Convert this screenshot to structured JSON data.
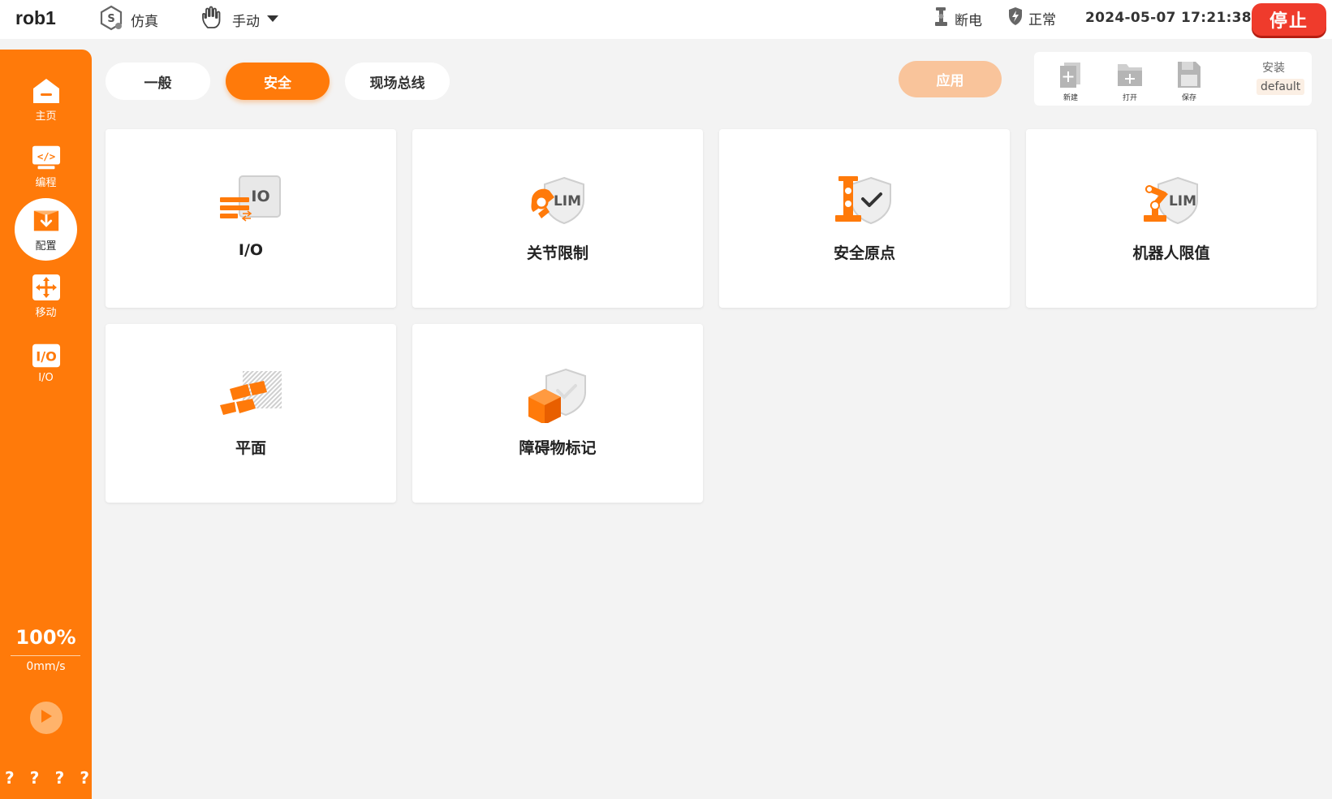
{
  "topbar": {
    "robot_name": "rob1",
    "sim_mode": "仿真",
    "manual_mode": "手动",
    "power_status": "断电",
    "safety_status": "正常",
    "datetime": "2024-05-07 17:21:38",
    "stop_label": "停止"
  },
  "sidebar": {
    "items": [
      {
        "label": "主页",
        "icon": "home-icon"
      },
      {
        "label": "编程",
        "icon": "code-icon"
      },
      {
        "label": "配置",
        "icon": "config-icon"
      },
      {
        "label": "移动",
        "icon": "move-icon"
      },
      {
        "label": "I/O",
        "icon": "io-icon"
      }
    ],
    "active_index": 2,
    "speed_percent": "100%",
    "speed_value": "0mm/s",
    "help": [
      "?",
      "?",
      "?",
      "?"
    ]
  },
  "tabs": [
    {
      "label": "一般",
      "active": false
    },
    {
      "label": "安全",
      "active": true
    },
    {
      "label": "现场总线",
      "active": false
    }
  ],
  "apply_label": "应用",
  "file_panel": {
    "new_label": "新建",
    "open_label": "打开",
    "save_label": "保存",
    "install_label": "安装",
    "install_value": "default"
  },
  "cards": [
    {
      "label": "I/O",
      "icon": "io-config-icon"
    },
    {
      "label": "关节限制",
      "icon": "joint-limit-icon"
    },
    {
      "label": "安全原点",
      "icon": "safe-home-icon"
    },
    {
      "label": "机器人限值",
      "icon": "robot-limit-icon"
    },
    {
      "label": "平面",
      "icon": "plane-icon"
    },
    {
      "label": "障碍物标记",
      "icon": "obstacle-icon"
    }
  ],
  "colors": {
    "accent": "#ff7a0a",
    "stop": "#ef3b2c",
    "background": "#f3f3f3"
  }
}
